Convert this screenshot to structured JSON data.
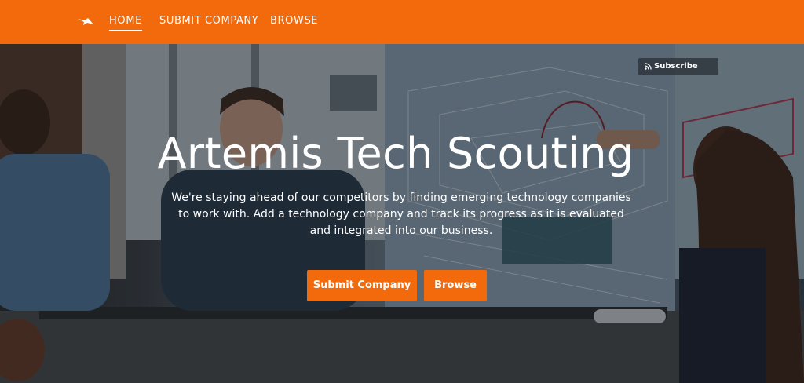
{
  "nav": {
    "brand_icon": "bird-logo-icon",
    "items": [
      {
        "label": "HOME",
        "active": true
      },
      {
        "label": "SUBMIT COMPANY",
        "active": false
      },
      {
        "label": "BROWSE",
        "active": false
      }
    ]
  },
  "hero": {
    "subscribe_label": "Subscribe",
    "subscribe_icon": "rss-icon",
    "title": "Artemis Tech Scouting",
    "tagline": "We're staying ahead of our competitors by finding emerging technology companies to work with. Add a technology company and track its progress as it is evaluated and integrated into our business.",
    "buttons": {
      "submit": "Submit Company",
      "browse": "Browse"
    }
  },
  "colors": {
    "accent": "#f26a0c",
    "text": "#ffffff"
  }
}
